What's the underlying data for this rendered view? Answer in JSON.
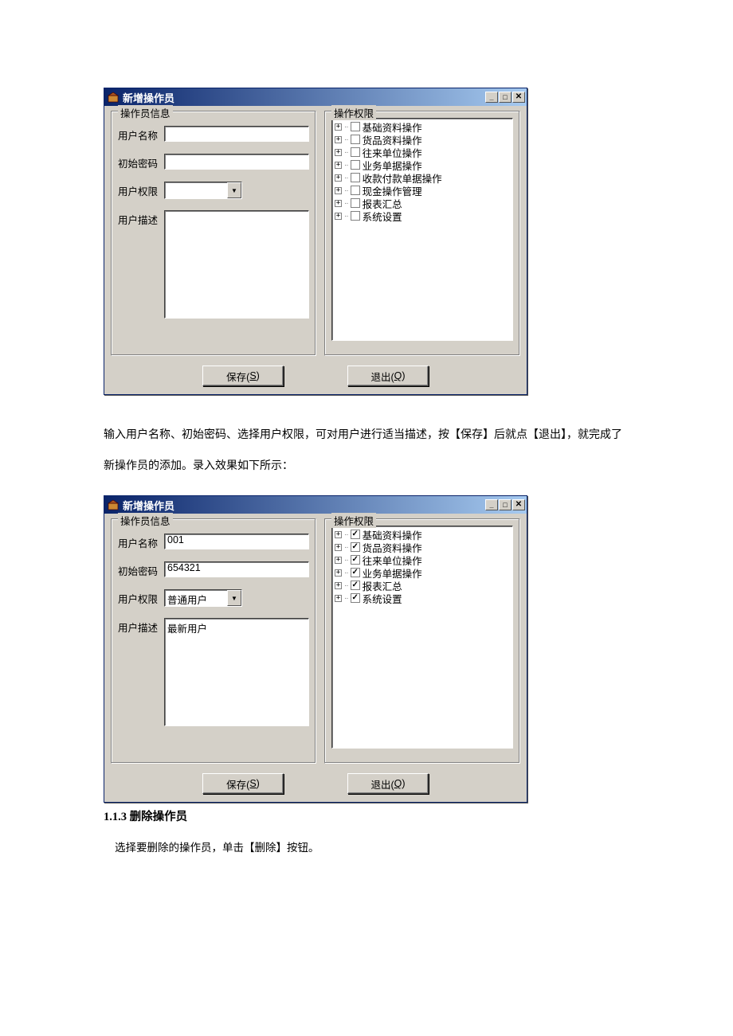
{
  "dialog1": {
    "title": "新增操作员",
    "groupOperatorInfo": "操作员信息",
    "groupPermissions": "操作权限",
    "labels": {
      "username": "用户名称",
      "password": "初始密码",
      "role": "用户权限",
      "desc": "用户描述"
    },
    "values": {
      "username": "",
      "password": "",
      "role": "",
      "desc": ""
    },
    "tree": [
      {
        "label": "基础资料操作",
        "checked": false
      },
      {
        "label": "货品资料操作",
        "checked": false
      },
      {
        "label": "往来单位操作",
        "checked": false
      },
      {
        "label": "业务单据操作",
        "checked": false
      },
      {
        "label": "收款付款单据操作",
        "checked": false
      },
      {
        "label": "现金操作管理",
        "checked": false
      },
      {
        "label": "报表汇总",
        "checked": false
      },
      {
        "label": "系统设置",
        "checked": false
      }
    ],
    "buttons": {
      "savePrefix": "保存(",
      "saveKey": "S",
      "saveSuffix": ")",
      "exitPrefix": "退出(",
      "exitKey": "Q",
      "exitSuffix": ")"
    }
  },
  "paragraph1": "输入用户名称、初始密码、选择用户权限，可对用户进行适当描述，按【保存】后就点【退出】，就完成了新操作员的添加。录入效果如下所示：",
  "dialog2": {
    "title": "新增操作员",
    "groupOperatorInfo": "操作员信息",
    "groupPermissions": "操作权限",
    "labels": {
      "username": "用户名称",
      "password": "初始密码",
      "role": "用户权限",
      "desc": "用户描述"
    },
    "values": {
      "username": "001",
      "password": "654321",
      "role": "普通用户",
      "desc": "最新用户"
    },
    "tree": [
      {
        "label": "基础资料操作",
        "checked": true
      },
      {
        "label": "货品资料操作",
        "checked": true
      },
      {
        "label": "往来单位操作",
        "checked": true
      },
      {
        "label": "业务单据操作",
        "checked": true
      },
      {
        "label": "报表汇总",
        "checked": true
      },
      {
        "label": "系统设置",
        "checked": true
      }
    ],
    "buttons": {
      "savePrefix": "保存(",
      "saveKey": "S",
      "saveSuffix": ")",
      "exitPrefix": "退出(",
      "exitKey": "Q",
      "exitSuffix": ")"
    }
  },
  "section": {
    "heading": "1.1.3 删除操作员",
    "text": "选择要删除的操作员，单击【删除】按钮。"
  }
}
